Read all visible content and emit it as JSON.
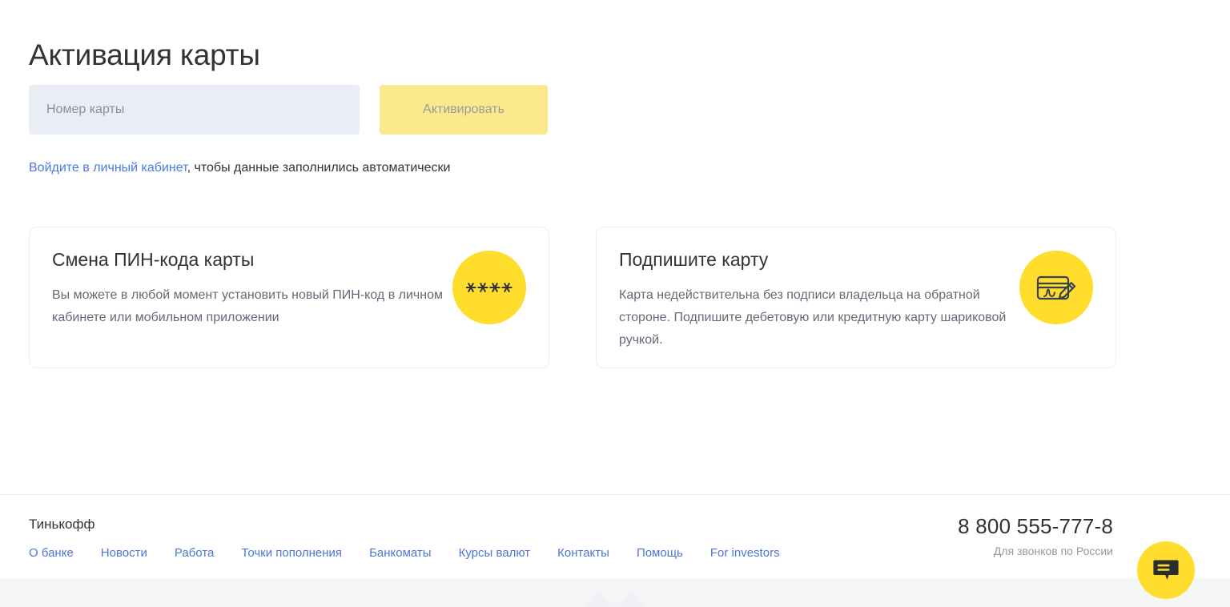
{
  "page": {
    "title": "Активация карты"
  },
  "form": {
    "card_number_placeholder": "Номер карты",
    "card_number_value": "",
    "activate_label": "Активировать",
    "activate_disabled": true
  },
  "hint": {
    "link_text": "Войдите в личный кабинет",
    "rest_text": ", чтобы данные заполнились автоматически"
  },
  "cards": [
    {
      "title": "Смена ПИН-кода карты",
      "body": "Вы можете в любой момент установить новый ПИН-код в личном кабинете или мобильном приложении",
      "icon": "pin-stars-icon",
      "icon_text": "∗∗∗∗"
    },
    {
      "title": "Подпишите карту",
      "body": "Карта недействительна без подписи владельца на обратной стороне. Подпишите дебетовую или кредитную карту шариковой ручкой.",
      "icon": "card-signature-icon",
      "icon_text": ""
    }
  ],
  "footer": {
    "brand": "Тинькофф",
    "links": [
      {
        "label": "О банке"
      },
      {
        "label": "Новости"
      },
      {
        "label": "Работа"
      },
      {
        "label": "Точки пополнения"
      },
      {
        "label": "Банкоматы"
      },
      {
        "label": "Курсы валют"
      },
      {
        "label": "Контакты"
      },
      {
        "label": "Помощь"
      },
      {
        "label": "For investors"
      }
    ],
    "phone": "8 800 555-777-8",
    "phone_note": "Для звонков по России"
  },
  "chat": {
    "icon": "chat-bubble-icon",
    "aria_label": "Чат"
  },
  "colors": {
    "brand_yellow": "#ffdd2d",
    "button_yellow": "#fde98d",
    "input_bg": "#e9edf4",
    "link_blue": "#4a76d8",
    "hint_link_blue": "#4a7ae0",
    "text_dark": "#333333",
    "text_muted": "#626b78",
    "band_gray": "#f5f6f8"
  }
}
